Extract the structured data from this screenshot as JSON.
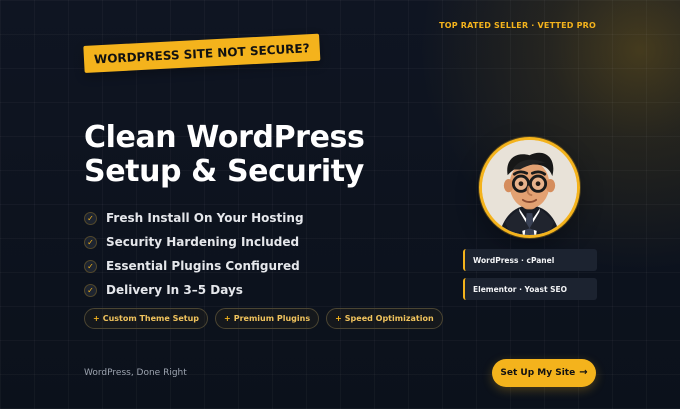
{
  "badge": {
    "tagline": "TOP RATED SELLER · VETTED PRO",
    "alert": "WORDPRESS SITE NOT SECURE?"
  },
  "hero": {
    "headline_line_1": "Clean WordPress",
    "headline_line_2": "Setup & Security"
  },
  "features": [
    {
      "icon": "check-icon",
      "text": "Fresh Install On Your Hosting"
    },
    {
      "icon": "check-icon",
      "text": "Security Hardening Included"
    },
    {
      "icon": "check-icon",
      "text": "Essential Plugins Configured"
    },
    {
      "icon": "check-icon",
      "text": "Delivery In 3–5 Days"
    }
  ],
  "addons": [
    {
      "prefix": "+",
      "label": "Custom Theme Setup"
    },
    {
      "prefix": "+",
      "label": "Premium Plugins"
    },
    {
      "prefix": "+",
      "label": "Speed Optimization"
    }
  ],
  "footer": {
    "tagline": "WordPress, Done Right",
    "cta_label": "Set Up My Site",
    "cta_arrow": "→"
  },
  "profile": {
    "avatar_icon": "cartoon-avatar-icon",
    "tech_stack": [
      "WordPress · cPanel",
      "Elementor · Yoast SEO"
    ]
  },
  "colors": {
    "background": "#0d121c",
    "accent": "#f4b31c",
    "card": "#1c2330",
    "text": "#f3f4f6",
    "muted": "#9ca3af"
  }
}
